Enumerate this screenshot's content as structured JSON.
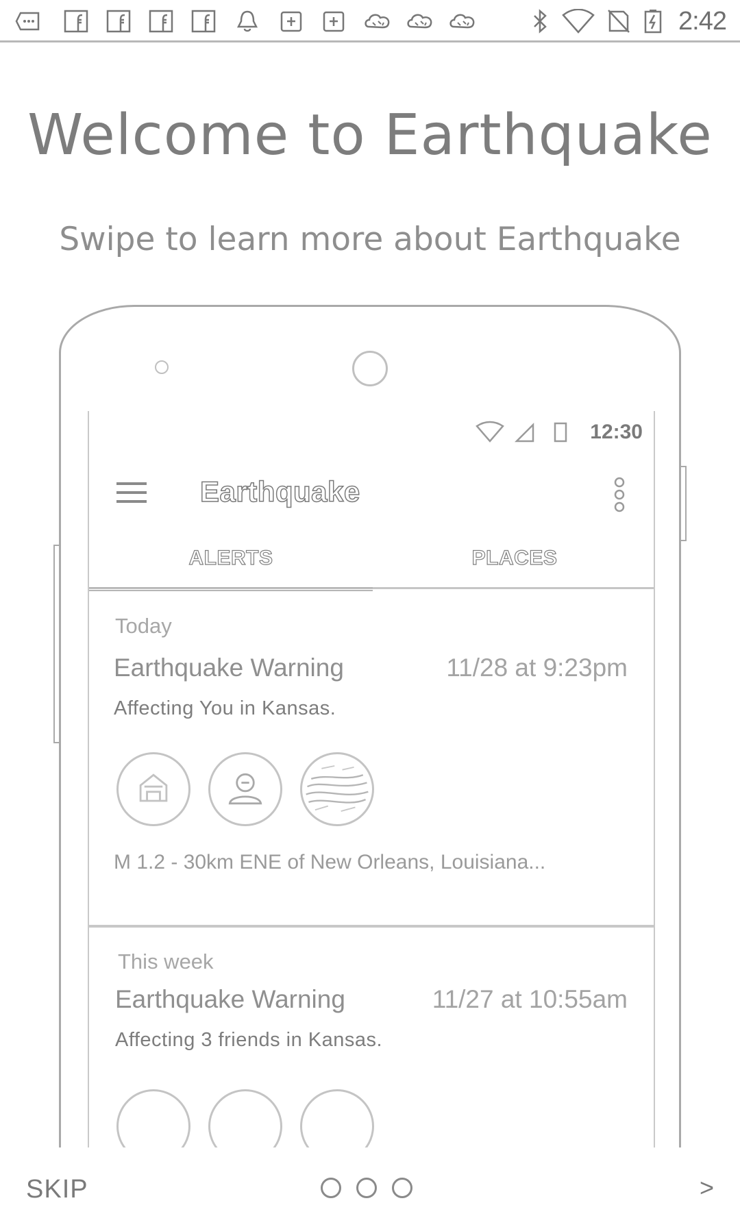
{
  "status_bar": {
    "time": "2:42",
    "icons": [
      "more-icon",
      "facebook-icon",
      "facebook-icon",
      "facebook-icon",
      "facebook-icon",
      "bell-icon",
      "calendar-icon",
      "calendar-icon",
      "weather-icon",
      "weather-icon",
      "weather-icon",
      "bluetooth-icon",
      "wifi-icon",
      "no-signal-icon",
      "battery-charging-icon"
    ]
  },
  "onboarding": {
    "title": "Welcome to Earthquake",
    "subtitle": "Swipe to learn more about Earthquake"
  },
  "phone_screen": {
    "status_time": "12:30",
    "app_title": "Earthquake",
    "tabs": [
      {
        "label": "ALERTS",
        "active": true
      },
      {
        "label": "PLACES",
        "active": false
      }
    ],
    "cards": [
      {
        "section": "Today",
        "title": "Earthquake Warning",
        "time": "11/28 at 9:23pm",
        "affecting": "Affecting You in Kansas.",
        "avatars": [
          "house-icon",
          "person-icon",
          "photo"
        ],
        "location": "M 1.2 - 30km ENE of New Orleans, Louisiana..."
      },
      {
        "section": "This week",
        "title": "Earthquake Warning",
        "time": "11/27 at 10:55am",
        "affecting": "Affecting 3 friends in Kansas."
      }
    ]
  },
  "bottom_nav": {
    "skip_label": "SKIP",
    "next_label": ">",
    "page_count": 3,
    "current_page": 1
  }
}
